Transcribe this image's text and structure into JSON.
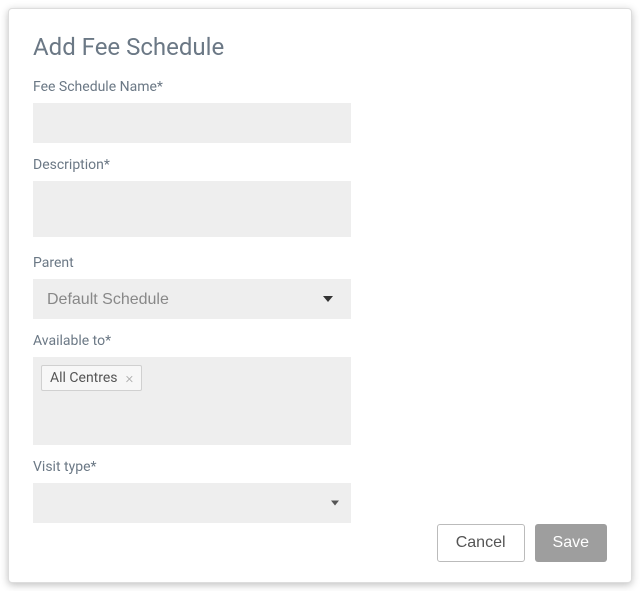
{
  "dialog": {
    "title": "Add Fee Schedule"
  },
  "fields": {
    "name": {
      "label": "Fee Schedule Name*",
      "value": ""
    },
    "description": {
      "label": "Description*",
      "value": ""
    },
    "parent": {
      "label": "Parent",
      "selected": "Default Schedule"
    },
    "available_to": {
      "label": "Available to*",
      "tags": [
        {
          "label": "All Centres"
        }
      ]
    },
    "visit_type": {
      "label": "Visit type*",
      "selected": ""
    }
  },
  "buttons": {
    "cancel": "Cancel",
    "save": "Save"
  }
}
